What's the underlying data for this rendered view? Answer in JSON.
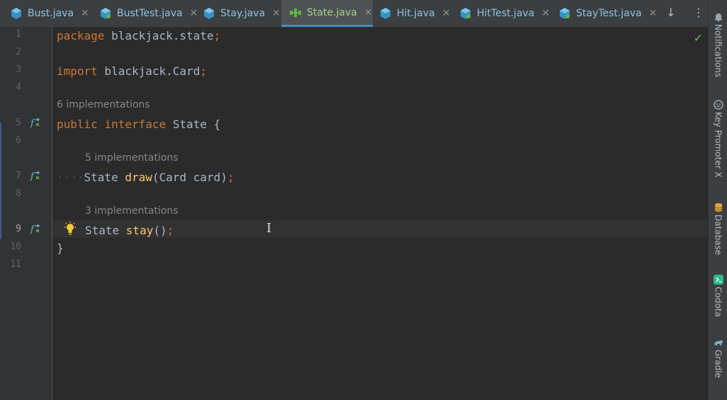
{
  "tabs": [
    {
      "label": "Bust.java",
      "icon": "java-class-icon",
      "color": "#3592c4"
    },
    {
      "label": "BustTest.java",
      "icon": "java-test-class-icon",
      "color": "#3592c4"
    },
    {
      "label": "Stay.java",
      "icon": "java-class-icon",
      "color": "#3592c4"
    },
    {
      "label": "State.java",
      "icon": "interface-icon",
      "color": "#62b543",
      "active": true
    },
    {
      "label": "Hit.java",
      "icon": "java-class-icon",
      "color": "#3592c4"
    },
    {
      "label": "HitTest.java",
      "icon": "java-test-class-icon",
      "color": "#3592c4"
    },
    {
      "label": "StayTest.java",
      "icon": "java-test-class-icon",
      "color": "#3592c4"
    }
  ],
  "tab_close_glyph": "✕",
  "tabbar": {
    "more_tabs_glyph": "↓",
    "menu_glyph": "⋮"
  },
  "editor": {
    "line_numbers": [
      "1",
      "2",
      "3",
      "4",
      "5",
      "6",
      "7",
      "8",
      "9",
      "10",
      "11"
    ],
    "current_line": "9",
    "code": {
      "l1_kw": "package",
      "l1_rest": " blackjack.state",
      "l1_semi": ";",
      "l3_kw": "import",
      "l3_rest": " blackjack.Card",
      "l3_semi": ";",
      "l5_kw1": "public",
      "l5_kw2": "interface",
      "l5_rest": " State {",
      "l7_type": "State ",
      "l7_fn": "draw",
      "l7_rest": "(Card card)",
      "l7_semi": ";",
      "l9_type": "State ",
      "l9_fn": "stay",
      "l9_rest": "()",
      "l9_semi": ";",
      "l10": "}"
    },
    "hints": {
      "interface_impls": "6 implementations",
      "draw_impls": "5 implementations",
      "stay_impls": "3 implementations"
    },
    "inspection_status": "✓"
  },
  "right_tools": [
    {
      "label": "Notifications",
      "icon": "bell-icon",
      "color": "#9aa7b0"
    },
    {
      "label": "Key Promoter X",
      "icon": "key-promoter-icon",
      "color": "#9aa7b0"
    },
    {
      "label": "Database",
      "icon": "database-icon",
      "color": "#e8a33d"
    },
    {
      "label": "Codota",
      "icon": "codota-icon",
      "color": "#2bbb8f"
    },
    {
      "label": "Gradle",
      "icon": "gradle-icon",
      "color": "#6cb5c9"
    }
  ],
  "colors": {
    "keyword": "#cc7832",
    "method": "#ffc66d",
    "text": "#a9b7c6",
    "accent": "#4a88c7"
  }
}
